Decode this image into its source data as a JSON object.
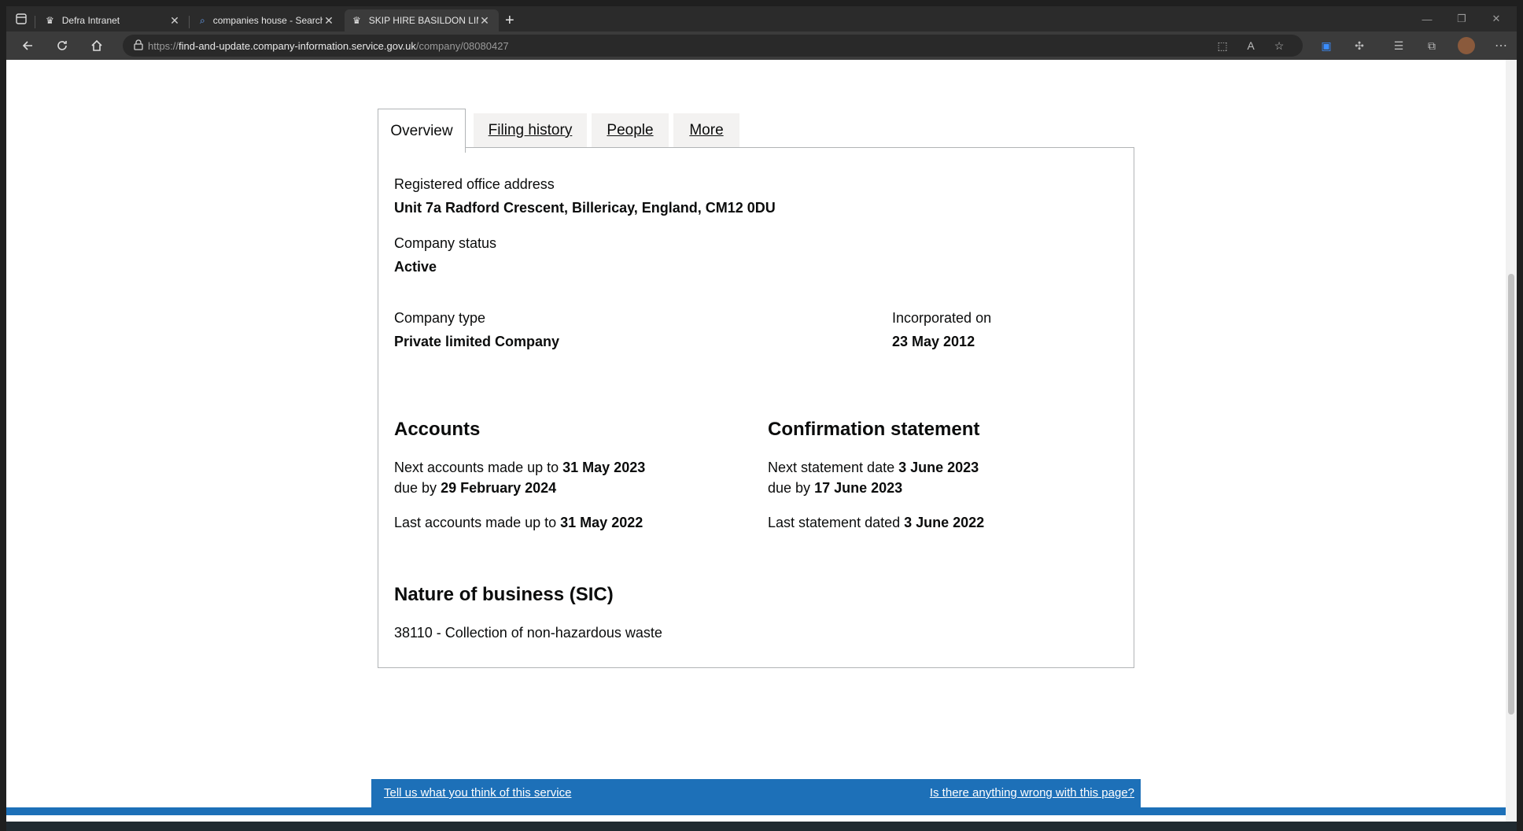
{
  "browser": {
    "tabs": [
      {
        "label": "Defra Intranet",
        "icon": "crown-icon"
      },
      {
        "label": "companies house - Search",
        "icon": "search-icon"
      },
      {
        "label": "SKIP HIRE BASILDON LIMITED ov",
        "icon": "crown-icon"
      }
    ],
    "url_prefix": "https://",
    "url_host": "find-and-update.company-information.service.gov.uk",
    "url_path": "/company/08080427"
  },
  "tabs": {
    "overview": "Overview",
    "filing_history": "Filing history",
    "people": "People",
    "more": "More"
  },
  "overview": {
    "registered_office_label": "Registered office address",
    "registered_office_value": "Unit 7a Radford Crescent, Billericay, England, CM12 0DU",
    "company_status_label": "Company status",
    "company_status_value": "Active",
    "company_type_label": "Company type",
    "company_type_value": "Private limited Company",
    "incorporated_label": "Incorporated on",
    "incorporated_value": "23 May 2012"
  },
  "accounts": {
    "heading": "Accounts",
    "next_prefix": "Next accounts made up to",
    "next_date": "31 May 2023",
    "due_prefix": "due by",
    "due_date": "29 February 2024",
    "last_prefix": "Last accounts made up to",
    "last_date": "31 May 2022"
  },
  "confirmation": {
    "heading": "Confirmation statement",
    "next_prefix": "Next statement date",
    "next_date": "3 June 2023",
    "due_prefix": "due by",
    "due_date": "17 June 2023",
    "last_prefix": "Last statement dated",
    "last_date": "3 June 2022"
  },
  "sic": {
    "heading": "Nature of business (SIC)",
    "value": "38110 - Collection of non-hazardous waste"
  },
  "feedback": {
    "left_link": "Tell us what you think of this service",
    "right_link": "Is there anything wrong with this page?"
  },
  "colors": {
    "gov_blue": "#1d70b8",
    "text": "#0b0c0c",
    "border": "#b1b4b6"
  }
}
